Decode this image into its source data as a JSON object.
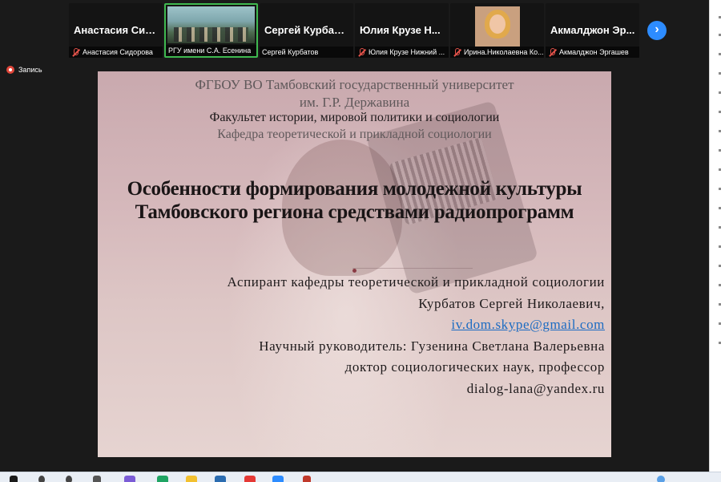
{
  "meeting": {
    "participants": [
      {
        "big_name": "Анастасия  Сид...",
        "caption": "Анастасия Сидорова",
        "type": "name"
      },
      {
        "big_name": "",
        "caption": "РГУ имени С.А. Есенина",
        "type": "video"
      },
      {
        "big_name": "Сергей Курбатов",
        "caption": "Сергей Курбатов",
        "type": "name"
      },
      {
        "big_name": "Юлия  Крузе  Н...",
        "caption": "Юлия Крузе Нижний ...",
        "type": "name"
      },
      {
        "big_name": "",
        "caption": "Ирина.Николаевна Ко...",
        "type": "photo"
      },
      {
        "big_name": "Акмалджон  Эр...",
        "caption": "Акмалджон Эргашев",
        "type": "name"
      }
    ],
    "next_icon": "›",
    "record_label": "Запись"
  },
  "slide": {
    "university_line1": "ФГБОУ ВО Тамбовский государственный университет",
    "university_line2": "им. Г.Р. Державина",
    "faculty": "Факультет истории, мировой политики и социологии",
    "department": "Кафедра теоретической и прикладной социологии",
    "title_line1": "Особенности формирования молодежной культуры",
    "title_line2": "Тамбовского региона средствами радиопрограмм",
    "author_role": "Аспирант кафедры теоретической и прикладной социологии",
    "author_name": "Курбатов Сергей Николаевич,",
    "author_email": "iv.dom.skype@gmail.com",
    "advisor": "Научный руководитель: Гузенина Светлана Валерьевна",
    "advisor_degree": "доктор социологических наук, профессор",
    "advisor_email": "dialog-lana@yandex.ru"
  },
  "colors": {
    "accent": "#2d8cff",
    "active_speaker": "#3fb950",
    "muted": "#e5534b",
    "record": "#e0463a",
    "link": "#1b6bc2"
  }
}
